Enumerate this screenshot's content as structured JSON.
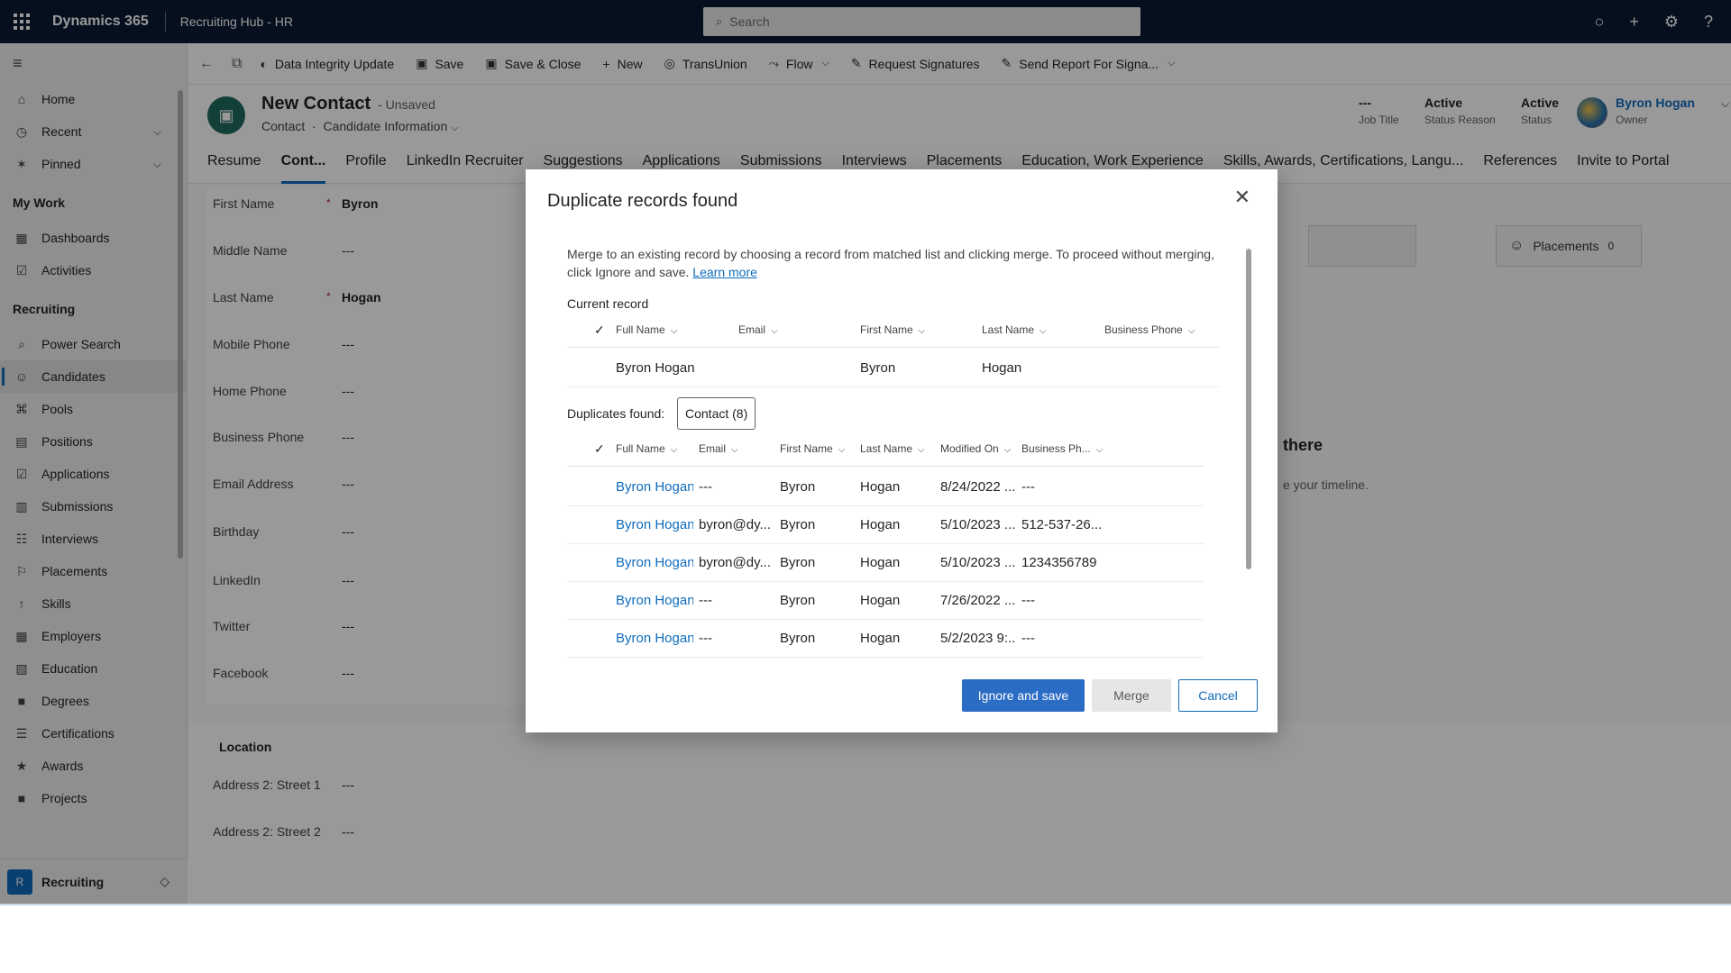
{
  "topbar": {
    "app_name": "Dynamics 365",
    "area": "Recruiting Hub - HR",
    "search_placeholder": "Search"
  },
  "leftnav": {
    "home": "Home",
    "recent": "Recent",
    "pinned": "Pinned",
    "my_work_title": "My Work",
    "my_work": [
      "Dashboards",
      "Activities"
    ],
    "recruiting_title": "Recruiting",
    "recruiting": [
      "Power Search",
      "Candidates",
      "Pools",
      "Positions",
      "Applications",
      "Submissions",
      "Interviews",
      "Placements",
      "Skills",
      "Employers",
      "Education",
      "Degrees",
      "Certifications",
      "Awards",
      "Projects"
    ],
    "selected": "Candidates",
    "area_badge": "R",
    "area_label": "Recruiting"
  },
  "commandbar": {
    "data_integrity": "Data Integrity Update",
    "save": "Save",
    "save_close": "Save & Close",
    "new": "New",
    "transunion": "TransUnion",
    "flow": "Flow",
    "request_signatures": "Request Signatures",
    "send_report": "Send Report For Signa..."
  },
  "record": {
    "title": "New Contact",
    "status": "- Unsaved",
    "entity": "Contact",
    "form": "Candidate Information",
    "job_title_value": "---",
    "job_title_label": "Job Title",
    "status_reason_value": "Active",
    "status_reason_label": "Status Reason",
    "status_value": "Active",
    "status_label": "Status",
    "owner_value": "Byron Hogan",
    "owner_label": "Owner"
  },
  "tabs": [
    "Resume",
    "Cont...",
    "Profile",
    "LinkedIn Recruiter",
    "Suggestions",
    "Applications",
    "Submissions",
    "Interviews",
    "Placements",
    "Education, Work Experience",
    "Skills, Awards, Certifications, Langu...",
    "References",
    "Invite to Portal"
  ],
  "form_fields": [
    {
      "label": "First Name",
      "value": "Byron",
      "required": "*"
    },
    {
      "label": "Middle Name",
      "value": "---",
      "required": ""
    },
    {
      "label": "Last Name",
      "value": "Hogan",
      "required": "*"
    },
    {
      "label": "Mobile Phone",
      "value": "---",
      "required": ""
    },
    {
      "label": "Home Phone",
      "value": "---",
      "required": ""
    },
    {
      "label": "Business Phone",
      "value": "---",
      "required": ""
    },
    {
      "label": "Email Address",
      "value": "---",
      "required": ""
    },
    {
      "label": "Birthday",
      "value": "---",
      "required": ""
    },
    {
      "label": "LinkedIn",
      "value": "---",
      "required": ""
    },
    {
      "label": "Twitter",
      "value": "---",
      "required": ""
    },
    {
      "label": "Facebook",
      "value": "---",
      "required": ""
    }
  ],
  "location": {
    "title": "Location",
    "fields": [
      {
        "label": "Address 2: Street 1",
        "value": "---"
      },
      {
        "label": "Address 2: Street 2",
        "value": "---"
      }
    ]
  },
  "side_panel": {
    "placements_label": "Placements",
    "placements_count": "0",
    "timeline_msg": "there",
    "timeline_sub": "e your timeline."
  },
  "dialog": {
    "title": "Duplicate records found",
    "description": "Merge to an existing record by choosing a record from matched list and clicking merge. To proceed without merging, click Ignore and save.",
    "learn_more": "Learn more",
    "current_record_label": "Current record",
    "current_columns": [
      "Full Name",
      "Email",
      "First Name",
      "Last Name",
      "Business Phone"
    ],
    "current_row": {
      "full_name": "Byron Hogan",
      "email": "",
      "first_name": "Byron",
      "last_name": "Hogan",
      "business_phone": ""
    },
    "duplicates_label": "Duplicates found:",
    "duplicates_tab": "Contact (8)",
    "dup_columns": [
      "Full Name",
      "Email",
      "First Name",
      "Last Name",
      "Modified On",
      "Business Ph..."
    ],
    "dup_rows": [
      {
        "full_name": "Byron Hogan",
        "email": "---",
        "first_name": "Byron",
        "last_name": "Hogan",
        "modified_on": "8/24/2022 ...",
        "business_phone": "---"
      },
      {
        "full_name": "Byron Hogan",
        "email": "byron@dy...",
        "first_name": "Byron",
        "last_name": "Hogan",
        "modified_on": "5/10/2023 ...",
        "business_phone": "512-537-26..."
      },
      {
        "full_name": "Byron Hogan",
        "email": "byron@dy...",
        "first_name": "Byron",
        "last_name": "Hogan",
        "modified_on": "5/10/2023 ...",
        "business_phone": "1234356789"
      },
      {
        "full_name": "Byron Hogan",
        "email": "---",
        "first_name": "Byron",
        "last_name": "Hogan",
        "modified_on": "7/26/2022 ...",
        "business_phone": "---"
      },
      {
        "full_name": "Byron Hogan",
        "email": "---",
        "first_name": "Byron",
        "last_name": "Hogan",
        "modified_on": "5/2/2023 9:...",
        "business_phone": "---"
      }
    ],
    "ignore_save": "Ignore and save",
    "merge": "Merge",
    "cancel": "Cancel"
  },
  "colors": {
    "topbar": "#0b1a33",
    "accent": "#0f6cbd",
    "primary_button": "#2b6cc4"
  }
}
